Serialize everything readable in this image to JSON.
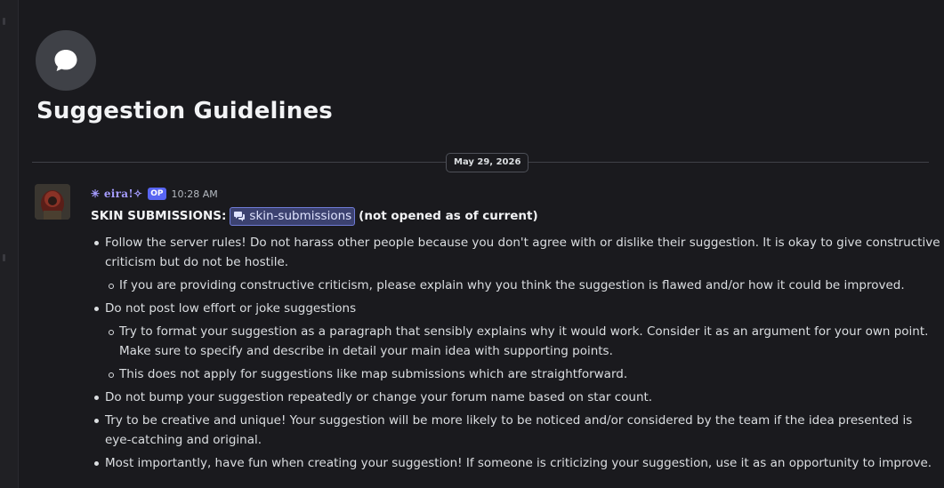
{
  "thread": {
    "icon": "chat-bubble-icon",
    "title": "Suggestion Guidelines",
    "date_divider": "May 29, 2026"
  },
  "message": {
    "avatar": "avatar",
    "username": "✳ eira!✧",
    "op_badge": "OP",
    "timestamp": "10:28 AM",
    "first_line": {
      "prefix": "SKIN SUBMISSIONS:",
      "channel_icon": "forum-channel-icon",
      "channel_name": "skin-submissions",
      "suffix": "(not opened as of current)"
    },
    "guidelines": [
      {
        "level": 0,
        "text": "Follow the server rules! Do not harass other people because you don't agree with or dislike their suggestion. It is okay to give constructive criticism but do not be hostile."
      },
      {
        "level": 1,
        "text": "If you are providing constructive criticism, please explain why you think the suggestion is flawed and/or how it could be improved."
      },
      {
        "level": 0,
        "text": "Do not post low effort or joke suggestions"
      },
      {
        "level": 1,
        "text": "Try to format your suggestion as a paragraph that sensibly explains why it would work. Consider it as an argument for your own point. Make sure to specify and describe in detail your main idea with supporting points."
      },
      {
        "level": 1,
        "text": "This does not apply for suggestions like map submissions which are straightforward."
      },
      {
        "level": 0,
        "text": "Do not bump your suggestion repeatedly or change your forum name based on star count."
      },
      {
        "level": 0,
        "text": "Try to be creative and unique! Your suggestion will be more likely to be noticed and/or considered by the team if the idea presented is eye-catching and original."
      },
      {
        "level": 0,
        "text": "Most importantly, have fun when creating your suggestion! If someone is criticizing your suggestion, use it as an opportunity to improve."
      }
    ]
  },
  "colors": {
    "background": "#1a1a1e",
    "username": "#a59cff",
    "op_badge": "#5865f2",
    "mention_bg": "#3c4270"
  }
}
